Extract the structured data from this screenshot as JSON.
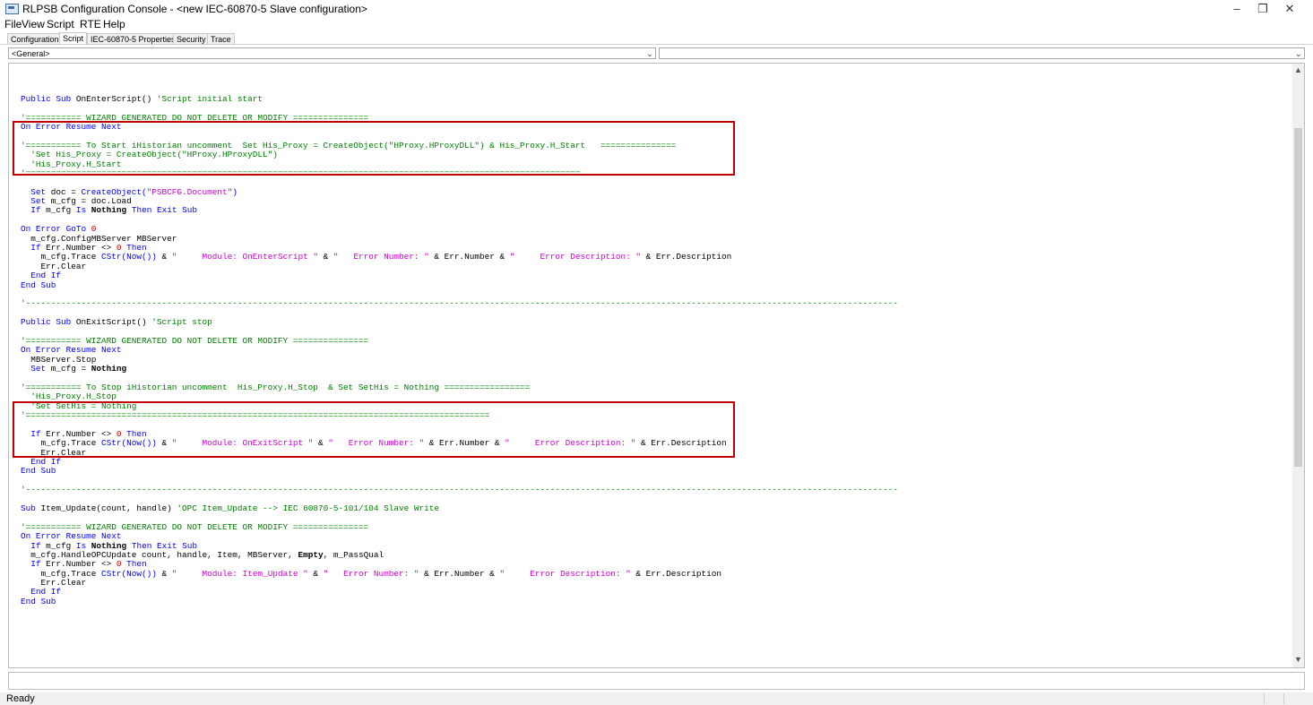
{
  "window": {
    "title": "RLPSB Configuration Console - <new IEC-60870-5 Slave configuration>",
    "minimize": "–",
    "maximize": "❐",
    "close": "✕"
  },
  "menu": {
    "file": "File",
    "view": "View",
    "script": "Script",
    "rte": "RTE",
    "help": "Help"
  },
  "tabs": [
    {
      "label": "Configuration"
    },
    {
      "label": "Script"
    },
    {
      "label": "IEC-60870-5 Properties"
    },
    {
      "label": "Security"
    },
    {
      "label": "Trace"
    }
  ],
  "selectors": {
    "object": "<General>",
    "procedure": ""
  },
  "code_lines": [
    [],
    [],
    [
      [
        "kw",
        "Public Sub "
      ],
      [
        "tx",
        "OnEnterScript() "
      ],
      [
        "cm",
        "'Script initial start"
      ]
    ],
    [],
    [
      [
        "cm",
        "'=========== WIZARD GENERATED DO NOT DELETE OR MODIFY ==============="
      ]
    ],
    [
      [
        "kw",
        "On Error Resume Next"
      ]
    ],
    [],
    [
      [
        "cm",
        "'=========== To Start iHistorian uncomment  Set His_Proxy = CreateObject(\"HProxy.HProxyDLL\") & His_Proxy.H_Start   ==============="
      ]
    ],
    [
      [
        "cm",
        "  'Set His_Proxy = CreateObject(\"HProxy.HProxyDLL\")"
      ]
    ],
    [
      [
        "cm",
        "  'His_Proxy.H_Start"
      ]
    ],
    [
      [
        "cm",
        "'=============================================================================================================="
      ]
    ],
    [],
    [
      [
        "kw",
        "  Set "
      ],
      [
        "tx",
        "doc = "
      ],
      [
        "kw",
        "CreateObject("
      ],
      [
        "st",
        "\"PSBCFG.Document\""
      ],
      [
        "kw",
        ")"
      ]
    ],
    [
      [
        "kw",
        "  Set "
      ],
      [
        "tx",
        "m_cfg = doc.Load"
      ]
    ],
    [
      [
        "kw",
        "  If "
      ],
      [
        "tx",
        "m_cfg "
      ],
      [
        "kw",
        "Is "
      ],
      [
        "bd",
        "Nothing "
      ],
      [
        "kw",
        "Then Exit Sub"
      ]
    ],
    [],
    [
      [
        "kw",
        "On Error GoTo "
      ],
      [
        "nm",
        "0"
      ]
    ],
    [
      [
        "tx",
        "  m_cfg.ConfigMBServer MBServer"
      ]
    ],
    [
      [
        "kw",
        "  If "
      ],
      [
        "tx",
        "Err.Number <> "
      ],
      [
        "nm",
        "0 "
      ],
      [
        "kw",
        "Then"
      ]
    ],
    [
      [
        "tx",
        "    m_cfg.Trace "
      ],
      [
        "kw",
        "CStr(Now()) "
      ],
      [
        "tx",
        "& "
      ],
      [
        "st",
        "\"     Module: OnEnterScript \""
      ],
      [
        "tx",
        " & "
      ],
      [
        "st",
        "\"   Error Number: \""
      ],
      [
        "tx",
        " & Err.Number & "
      ],
      [
        "st",
        "\"     Error Description: \""
      ],
      [
        "tx",
        " & Err.Description"
      ]
    ],
    [
      [
        "tx",
        "    Err.Clear"
      ]
    ],
    [
      [
        "kw",
        "  End If"
      ]
    ],
    [
      [
        "kw",
        "End Sub"
      ]
    ],
    [],
    [
      [
        "cm",
        "'-----------------------------------------------------------------------------------------------------------------------------------------------------------------------------"
      ]
    ],
    [],
    [
      [
        "kw",
        "Public Sub "
      ],
      [
        "tx",
        "OnExitScript() "
      ],
      [
        "cm",
        "'Script stop"
      ]
    ],
    [],
    [
      [
        "cm",
        "'=========== WIZARD GENERATED DO NOT DELETE OR MODIFY ==============="
      ]
    ],
    [
      [
        "kw",
        "On Error Resume Next"
      ]
    ],
    [
      [
        "tx",
        "  MBServer.Stop"
      ]
    ],
    [
      [
        "kw",
        "  Set "
      ],
      [
        "tx",
        "m_cfg = "
      ],
      [
        "bd",
        "Nothing"
      ]
    ],
    [],
    [
      [
        "cm",
        "'=========== To Stop iHistorian uncomment  His_Proxy.H_Stop  & Set SetHis = Nothing ================="
      ]
    ],
    [
      [
        "cm",
        "  'His_Proxy.H_Stop"
      ]
    ],
    [
      [
        "cm",
        "  'Set SetHis = Nothing"
      ]
    ],
    [
      [
        "cm",
        "'============================================================================================"
      ]
    ],
    [],
    [
      [
        "kw",
        "  If "
      ],
      [
        "tx",
        "Err.Number <> "
      ],
      [
        "nm",
        "0 "
      ],
      [
        "kw",
        "Then"
      ]
    ],
    [
      [
        "tx",
        "    m_cfg.Trace "
      ],
      [
        "kw",
        "CStr(Now()) "
      ],
      [
        "tx",
        "& "
      ],
      [
        "st",
        "\"     Module: OnExitScript \""
      ],
      [
        "tx",
        " & "
      ],
      [
        "st",
        "\"   Error Number: \""
      ],
      [
        "tx",
        " & Err.Number & "
      ],
      [
        "st",
        "\"     Error Description: \""
      ],
      [
        "tx",
        " & Err.Description"
      ]
    ],
    [
      [
        "tx",
        "    Err.Clear"
      ]
    ],
    [
      [
        "kw",
        "  End If"
      ]
    ],
    [
      [
        "kw",
        "End Sub"
      ]
    ],
    [],
    [
      [
        "cm",
        "'-----------------------------------------------------------------------------------------------------------------------------------------------------------------------------"
      ]
    ],
    [],
    [
      [
        "kw",
        "Sub "
      ],
      [
        "tx",
        "Item_Update(count, handle) "
      ],
      [
        "cm",
        "'OPC Item_Update --> IEC 60870-5-101/104 Slave Write"
      ]
    ],
    [],
    [
      [
        "cm",
        "'=========== WIZARD GENERATED DO NOT DELETE OR MODIFY ==============="
      ]
    ],
    [
      [
        "kw",
        "On Error Resume Next"
      ]
    ],
    [
      [
        "kw",
        "  If "
      ],
      [
        "tx",
        "m_cfg "
      ],
      [
        "kw",
        "Is "
      ],
      [
        "bd",
        "Nothing "
      ],
      [
        "kw",
        "Then Exit Sub"
      ]
    ],
    [
      [
        "tx",
        "  m_cfg.HandleOPCUpdate count, handle, Item, MBServer, "
      ],
      [
        "bd",
        "Empty"
      ],
      [
        "tx",
        ", m_PassQual"
      ]
    ],
    [
      [
        "kw",
        "  If "
      ],
      [
        "tx",
        "Err.Number <> "
      ],
      [
        "nm",
        "0 "
      ],
      [
        "kw",
        "Then"
      ]
    ],
    [
      [
        "tx",
        "    m_cfg.Trace "
      ],
      [
        "kw",
        "CStr(Now()) "
      ],
      [
        "tx",
        "& "
      ],
      [
        "st",
        "\"     Module: Item_Update \""
      ],
      [
        "tx",
        " & "
      ],
      [
        "st",
        "\"   Error Number: \""
      ],
      [
        "tx",
        " & Err.Number & "
      ],
      [
        "st",
        "\"     Error Description: \""
      ],
      [
        "tx",
        " & Err.Description"
      ]
    ],
    [
      [
        "tx",
        "    Err.Clear"
      ]
    ],
    [
      [
        "kw",
        "  End If"
      ]
    ],
    [
      [
        "kw",
        "End Sub"
      ]
    ]
  ],
  "scroll": {
    "up": "▲",
    "down": "▼"
  },
  "command_input": "",
  "status": {
    "text": "Ready"
  }
}
